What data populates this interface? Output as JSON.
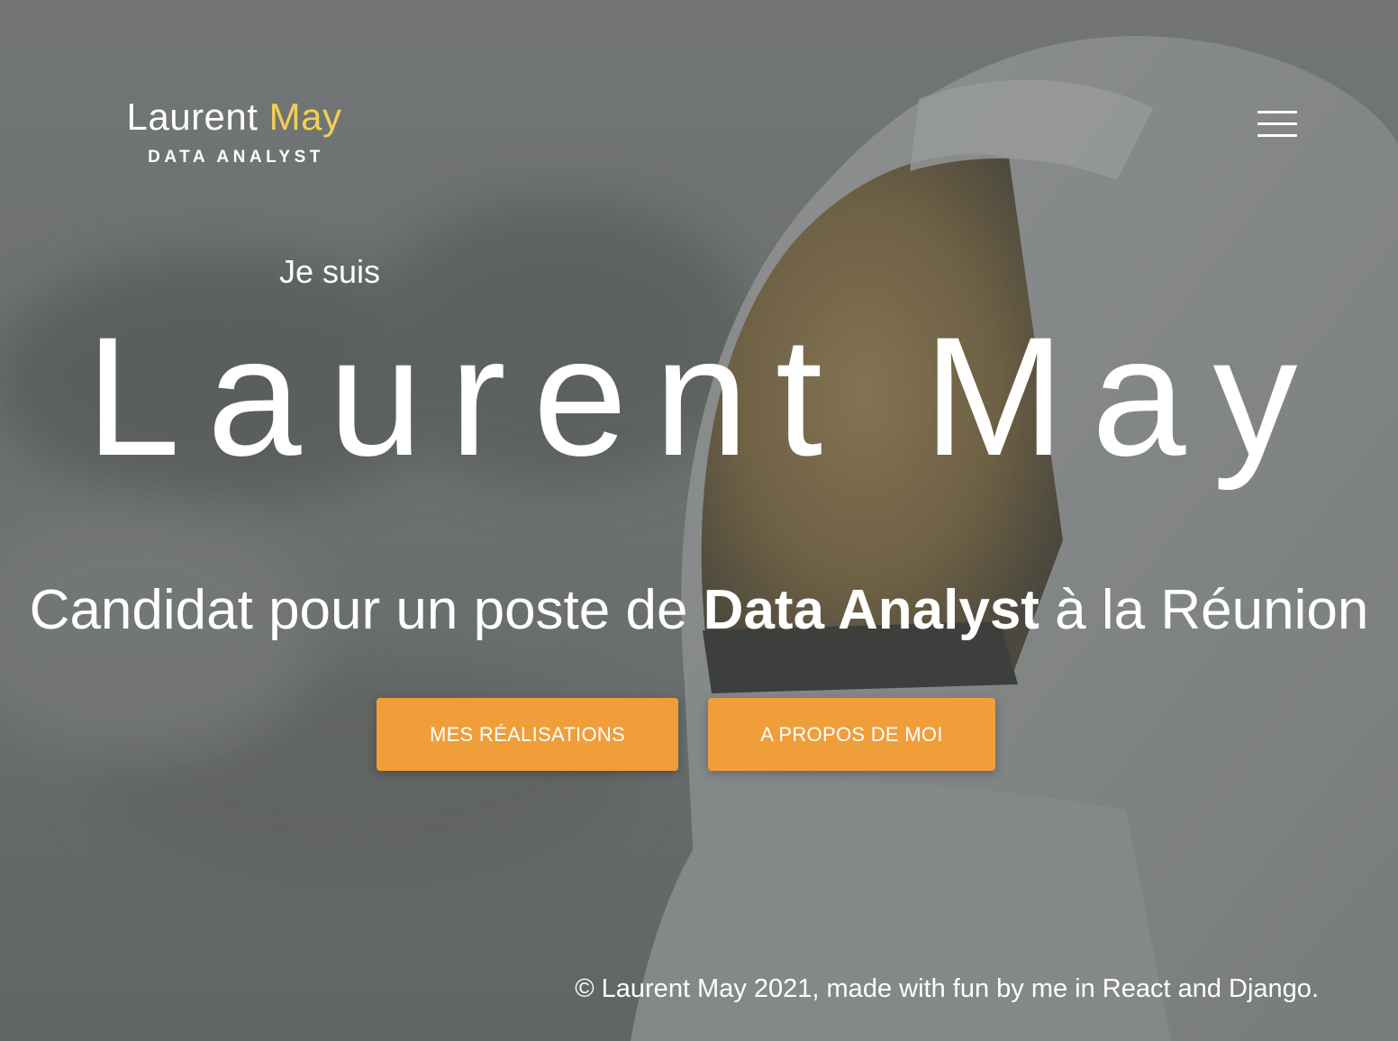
{
  "header": {
    "brand_first": "Laurent",
    "brand_last": "May",
    "brand_role": "DATA ANALYST",
    "menu_icon": "hamburger-menu-icon"
  },
  "hero": {
    "intro": "Je suis",
    "name": "Laurent May",
    "tagline_before": "Candidat pour un poste de ",
    "tagline_bold": "Data Analyst",
    "tagline_after": " à la Réunion"
  },
  "buttons": {
    "work_label": "MES RÉALISATIONS",
    "about_label": "A PROPOS DE MOI"
  },
  "footer": {
    "text": "© Laurent May 2021, made with fun by me in React and Django."
  },
  "colors": {
    "accent": "#f09e3a",
    "brand_highlight": "#f2cf55",
    "overlay": "#6f7274"
  }
}
